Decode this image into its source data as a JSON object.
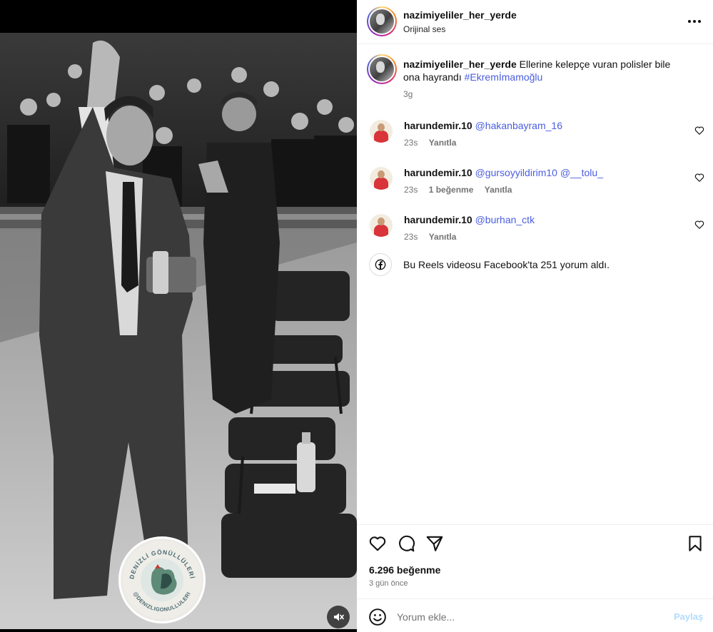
{
  "post": {
    "username": "nazimiyeliler_her_yerde",
    "audio": "Orijinal ses",
    "caption_text": "Ellerine kelepçe vuran polisler bile ona hayrandı",
    "caption_hashtag": "#Ekremİmamoğlu",
    "caption_time": "3g"
  },
  "watermark": {
    "top_text": "DENİZLİ GÖNÜLLÜLERİ",
    "bottom_text": "@DENIZLIGONULLULERI"
  },
  "comments": [
    {
      "user": "harundemir.10",
      "mentions": "@hakanbayram_16",
      "time": "23s",
      "likes": "",
      "reply": "Yanıtla"
    },
    {
      "user": "harundemir.10",
      "mentions": "@gursoyyildirim10 @__tolu_",
      "time": "23s",
      "likes": "1 beğenme",
      "reply": "Yanıtla"
    },
    {
      "user": "harundemir.10",
      "mentions": "@burhan_ctk",
      "time": "23s",
      "likes": "",
      "reply": "Yanıtla"
    }
  ],
  "facebook_note": "Bu Reels videosu Facebook'ta 251 yorum aldı.",
  "stats": {
    "likes": "6.296 beğenme",
    "date": "3 gün önce"
  },
  "composer": {
    "placeholder": "Yorum ekle...",
    "share_label": "Paylaş"
  },
  "icons": {
    "more": "more-options-icon",
    "heart": "heart-icon",
    "comment": "comment-icon",
    "share": "share-icon",
    "save": "bookmark-icon",
    "emoji": "emoji-icon",
    "facebook": "facebook-icon",
    "mute": "muted-speaker-icon"
  },
  "colors": {
    "link": "#4a5de0",
    "muted_text": "#737373",
    "share_disabled": "#b3dbff"
  }
}
